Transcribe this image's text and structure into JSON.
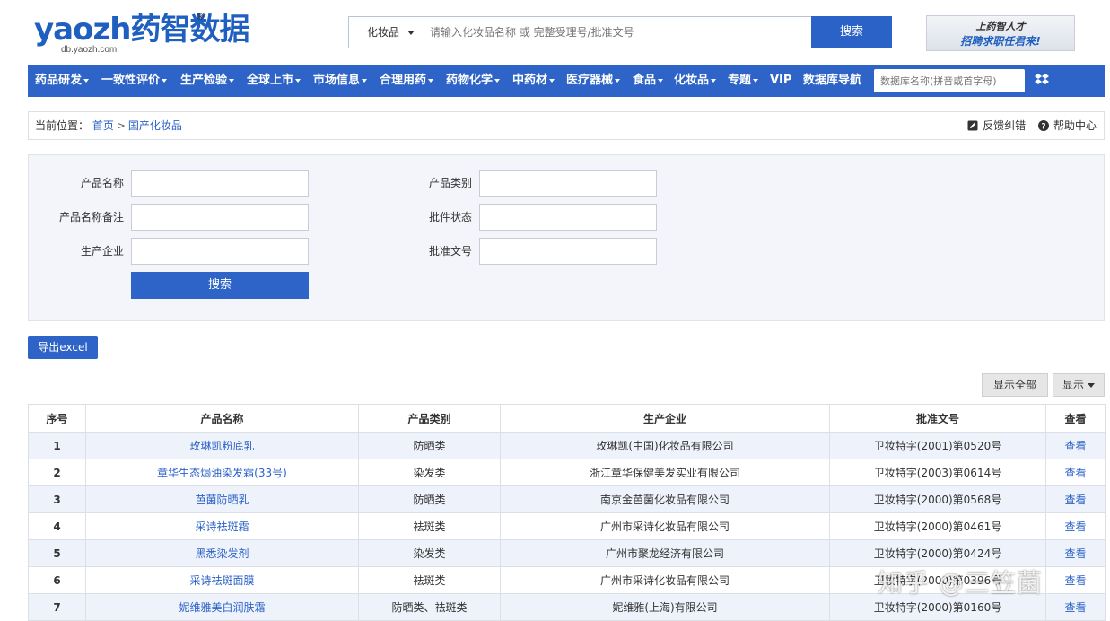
{
  "header": {
    "logo_left": "yaozh",
    "logo_right": "药智数据",
    "logo_domain": "db.yaozh.com",
    "logo_mark": "®",
    "search": {
      "category": "化妆品",
      "placeholder": "请输入化妆品名称 或 完整受理号/批准文号",
      "button": "搜索"
    },
    "recruit": {
      "line1": "上药智人才",
      "line2": "招聘求职任君来!"
    }
  },
  "nav": {
    "items": [
      {
        "label": "药品研发",
        "dropdown": true
      },
      {
        "label": "一致性评价",
        "dropdown": true
      },
      {
        "label": "生产检验",
        "dropdown": true
      },
      {
        "label": "全球上市",
        "dropdown": true
      },
      {
        "label": "市场信息",
        "dropdown": true
      },
      {
        "label": "合理用药",
        "dropdown": true
      },
      {
        "label": "药物化学",
        "dropdown": true
      },
      {
        "label": "中药材",
        "dropdown": true
      },
      {
        "label": "医疗器械",
        "dropdown": true
      },
      {
        "label": "食品",
        "dropdown": true
      },
      {
        "label": "化妆品",
        "dropdown": true
      },
      {
        "label": "专题",
        "dropdown": true
      },
      {
        "label": "VIP",
        "dropdown": false
      },
      {
        "label": "数据库导航",
        "dropdown": false
      }
    ],
    "search_placeholder": "数据库名称(拼音或首字母)"
  },
  "breadcrumb": {
    "prefix": "当前位置：",
    "home": "首页",
    "separator": ">",
    "current": "国产化妆品",
    "feedback": "反馈纠错",
    "help": "帮助中心"
  },
  "filter": {
    "product_name": "产品名称",
    "product_category": "产品类别",
    "name_remark": "产品名称备注",
    "approval_status": "批件状态",
    "manufacturer": "生产企业",
    "approval_number": "批准文号",
    "search_button": "搜索"
  },
  "toolbar": {
    "export": "导出excel",
    "show_all": "显示全部",
    "show_columns": "显示"
  },
  "table": {
    "headers": [
      "序号",
      "产品名称",
      "产品类别",
      "生产企业",
      "批准文号",
      "查看"
    ],
    "rows": [
      [
        "1",
        "玫琳凯粉底乳",
        "防晒类",
        "玫琳凯(中国)化妆品有限公司",
        "卫妆特字(2001)第0520号",
        "查看"
      ],
      [
        "2",
        "章华生态焗油染发霜(33号)",
        "染发类",
        "浙江章华保健美发实业有限公司",
        "卫妆特字(2003)第0614号",
        "查看"
      ],
      [
        "3",
        "芭菌防晒乳",
        "防晒类",
        "南京金芭菌化妆品有限公司",
        "卫妆特字(2000)第0568号",
        "查看"
      ],
      [
        "4",
        "采诗祛斑霜",
        "祛斑类",
        "广州市采诗化妆品有限公司",
        "卫妆特字(2000)第0461号",
        "查看"
      ],
      [
        "5",
        "黑悉染发剂",
        "染发类",
        "广州市聚龙经济有限公司",
        "卫妆特字(2000)第0424号",
        "查看"
      ],
      [
        "6",
        "采诗祛斑面膜",
        "祛斑类",
        "广州市采诗化妆品有限公司",
        "卫妆特字(2000)第0396号",
        "查看"
      ],
      [
        "7",
        "妮维雅美白润肤霜",
        "防晒类、祛斑类",
        "妮维雅(上海)有限公司",
        "卫妆特字(2000)第0160号",
        "查看"
      ]
    ]
  },
  "watermark": "知乎 @三笠菌",
  "colors": {
    "brand_blue": "#2e64c8",
    "link_blue": "#2b62c7",
    "logo_red": "#e23a2c",
    "row_alt": "#eef2fa"
  }
}
